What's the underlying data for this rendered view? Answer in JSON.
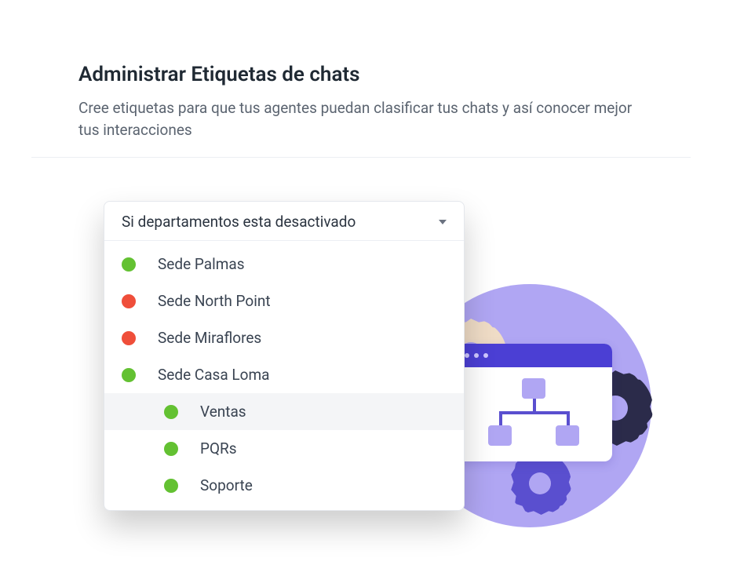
{
  "header": {
    "title": "Administrar Etiquetas de chats",
    "description": "Cree etiquetas para que tus agentes puedan clasificar tus chats y así conocer mejor tus interacciones"
  },
  "dropdown": {
    "label": "Si departamentos esta desactivado",
    "items": [
      {
        "label": "Sede Palmas",
        "status": "green",
        "child": false,
        "selected": false
      },
      {
        "label": "Sede North Point",
        "status": "red",
        "child": false,
        "selected": false
      },
      {
        "label": "Sede Miraflores",
        "status": "red",
        "child": false,
        "selected": false
      },
      {
        "label": "Sede Casa Loma",
        "status": "green",
        "child": false,
        "selected": false
      },
      {
        "label": "Ventas",
        "status": "green",
        "child": true,
        "selected": true
      },
      {
        "label": "PQRs",
        "status": "green",
        "child": true,
        "selected": false
      },
      {
        "label": "Soporte",
        "status": "green",
        "child": true,
        "selected": false
      }
    ]
  },
  "colors": {
    "green": "#63c132",
    "red": "#ef4e3a",
    "accent_purple": "#b0a6f3",
    "accent_deep": "#4b3fd4"
  }
}
